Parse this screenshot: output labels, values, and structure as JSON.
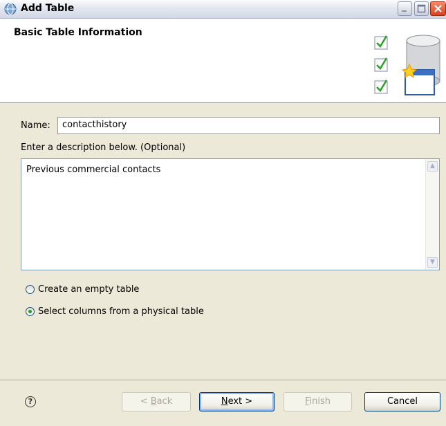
{
  "window": {
    "title": "Add Table",
    "icon": "app-globe-icon",
    "controls": [
      "minimize-icon",
      "maximize-icon",
      "close-icon"
    ]
  },
  "banner": {
    "title": "Basic Table Information",
    "graphic": "database-wizard-icon"
  },
  "form": {
    "name_label": "Name:",
    "name_value": "contacthistory",
    "description_label": "Enter a description below. (Optional)",
    "description_value": "Previous commercial contacts"
  },
  "options": [
    {
      "label": "Create an empty table",
      "selected": false
    },
    {
      "label": "Select columns from a physical table",
      "selected": true
    }
  ],
  "footer": {
    "help_icon": "help-icon",
    "back": {
      "prefix": "< ",
      "mnemonic": "B",
      "rest": "ack",
      "enabled": false
    },
    "next": {
      "mnemonic": "N",
      "rest": "ext >",
      "enabled": true
    },
    "finish": {
      "mnemonic": "F",
      "rest": "inish",
      "enabled": false
    },
    "cancel": {
      "label": "Cancel",
      "enabled": true
    }
  },
  "colors": {
    "dialog_bg": "#ece9d8",
    "banner_bg": "#ffffff",
    "input_border": "#7f9db9",
    "check_green": "#2aa02a",
    "close_red": "#d9431f"
  }
}
